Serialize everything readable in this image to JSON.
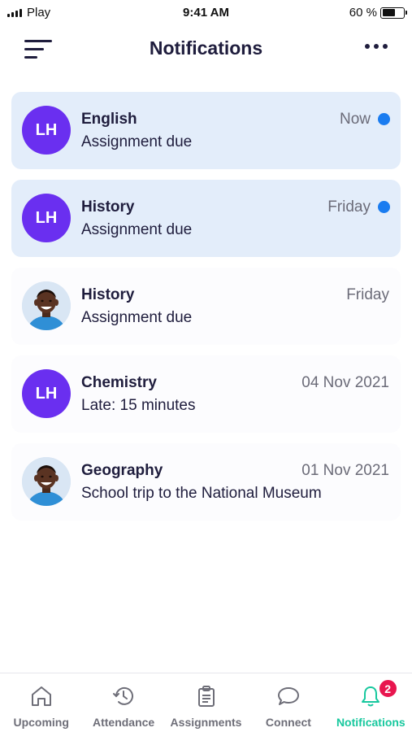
{
  "status_bar": {
    "carrier": "Play",
    "time": "9:41 AM",
    "battery": "60 %"
  },
  "header": {
    "title": "Notifications",
    "menu_icon": "menu-lines-icon",
    "more_icon": "more-dots-icon"
  },
  "notifications": [
    {
      "avatar_type": "initials",
      "avatar_text": "LH",
      "subject": "English",
      "message": "Assignment due",
      "date": "Now",
      "unread": true
    },
    {
      "avatar_type": "initials",
      "avatar_text": "LH",
      "subject": "History",
      "message": "Assignment due",
      "date": "Friday",
      "unread": true
    },
    {
      "avatar_type": "photo",
      "avatar_text": "",
      "subject": "History",
      "message": "Assignment due",
      "date": "Friday",
      "unread": false
    },
    {
      "avatar_type": "initials",
      "avatar_text": "LH",
      "subject": "Chemistry",
      "message": "Late: 15 minutes",
      "date": "04 Nov 2021",
      "unread": false
    },
    {
      "avatar_type": "photo",
      "avatar_text": "",
      "subject": "Geography",
      "message": "School trip to the National Museum",
      "date": "01 Nov 2021",
      "unread": false
    }
  ],
  "tabs": [
    {
      "label": "Upcoming",
      "icon": "home-icon",
      "active": false
    },
    {
      "label": "Attendance",
      "icon": "history-clock-icon",
      "active": false
    },
    {
      "label": "Assignments",
      "icon": "clipboard-icon",
      "active": false
    },
    {
      "label": "Connect",
      "icon": "chat-bubble-icon",
      "active": false
    },
    {
      "label": "Notifications",
      "icon": "bell-icon",
      "active": true,
      "badge": "2"
    }
  ],
  "colors": {
    "primary_text": "#1f1d3d",
    "unread_background": "#e3edfa",
    "unread_dot": "#1a7cf0",
    "avatar_purple": "#6a2ff0",
    "active_tab": "#18c89e",
    "inactive_tab": "#6e6e78",
    "badge": "#e8164f"
  }
}
